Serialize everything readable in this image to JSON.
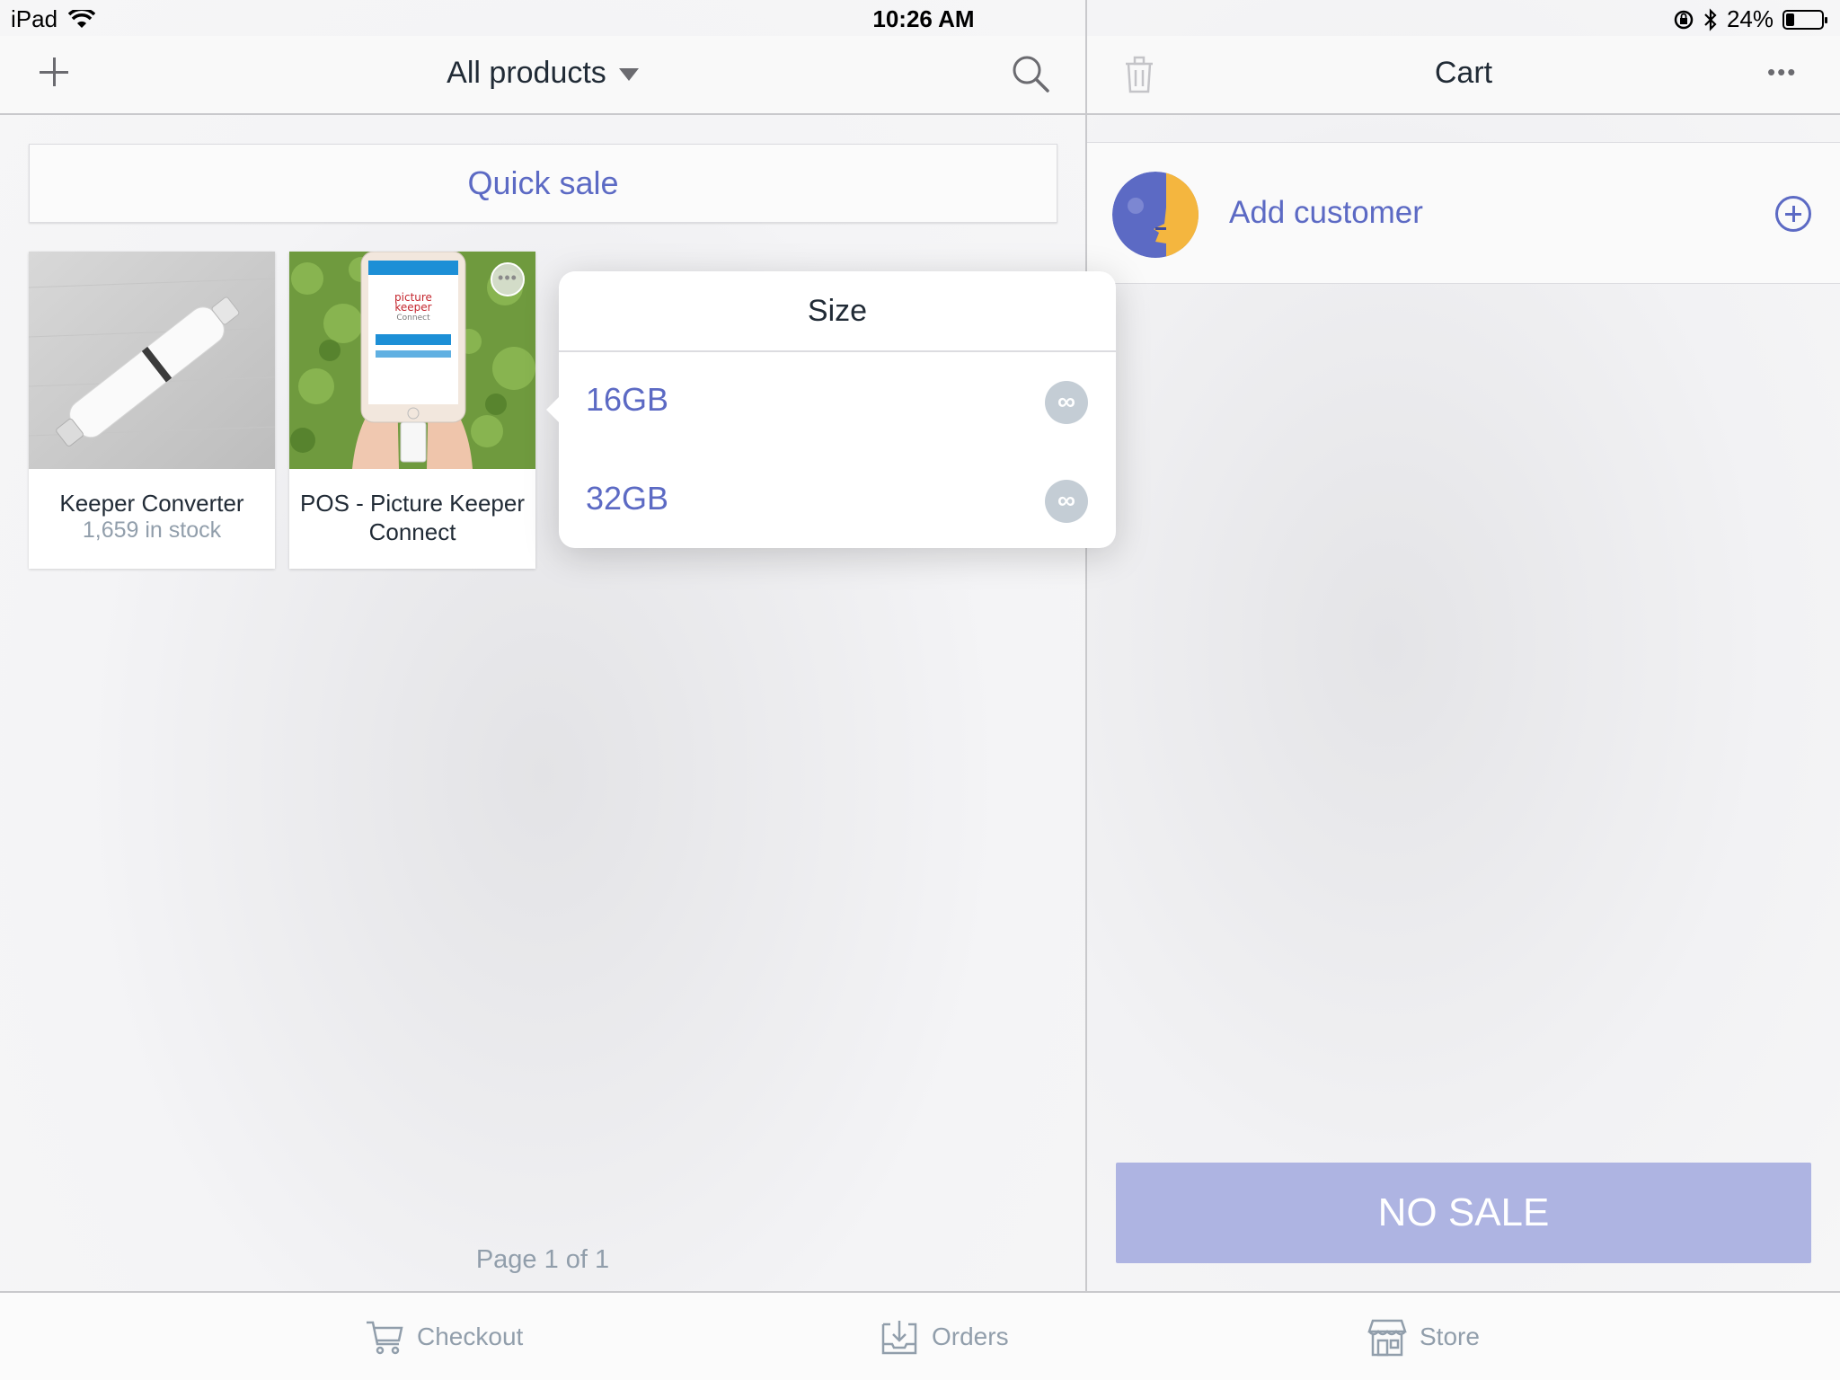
{
  "status_bar": {
    "device": "iPad",
    "time": "10:26 AM",
    "battery_percent": "24%",
    "battery_level": 0.24
  },
  "products_header": {
    "title": "All products"
  },
  "quick_sale_label": "Quick sale",
  "products": [
    {
      "name": "Keeper Converter",
      "stock": "1,659 in stock"
    },
    {
      "name": "POS - Picture Keeper Connect",
      "stock": ""
    }
  ],
  "product_image_text": {
    "brand_line1": "picture",
    "brand_line2": "keeper",
    "brand_line3": "Connect"
  },
  "page_indicator": "Page 1 of 1",
  "cart_header": {
    "title": "Cart"
  },
  "customer": {
    "add_label": "Add customer"
  },
  "no_sale_label": "NO SALE",
  "variant_popover": {
    "title": "Size",
    "options": [
      {
        "label": "16GB",
        "badge": "∞"
      },
      {
        "label": "32GB",
        "badge": "∞"
      }
    ]
  },
  "tabs": [
    {
      "label": "Checkout",
      "icon": "cart-icon"
    },
    {
      "label": "Orders",
      "icon": "orders-inbox-icon"
    },
    {
      "label": "Store",
      "icon": "store-icon"
    }
  ],
  "colors": {
    "accent": "#5c6ac4",
    "no_sale_bg": "#aeb4e2",
    "avatar_blue": "#5c6ac4",
    "avatar_orange": "#f4b63f",
    "badge_gray": "#c4cdd5"
  }
}
